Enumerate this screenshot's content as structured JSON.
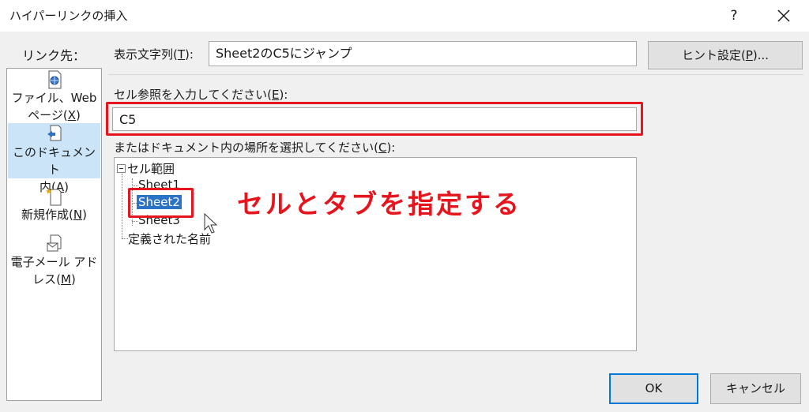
{
  "window": {
    "title": "ハイパーリンクの挿入",
    "help": "?"
  },
  "link_to": {
    "label": "リンク先：",
    "items": [
      {
        "label_line1": "ファイル、Web",
        "label_line2_pre": "ページ(",
        "mnemonic": "X",
        "label_line2_post": ")",
        "icon": "web-file-icon",
        "active": false
      },
      {
        "label_line1": "このドキュメント",
        "label_line2_pre": "内(",
        "mnemonic": "A",
        "label_line2_post": ")",
        "icon": "document-place-icon",
        "active": true
      },
      {
        "label_line1": "",
        "label_line2_pre": "新規作成(",
        "mnemonic": "N",
        "label_line2_post": ")",
        "icon": "new-document-icon",
        "active": false
      },
      {
        "label_line1": "電子メール アド",
        "label_line2_pre": "レス(",
        "mnemonic": "M",
        "label_line2_post": ")",
        "icon": "email-icon",
        "active": false
      }
    ]
  },
  "display_text": {
    "label_pre": "表示文字列(",
    "mnemonic": "T",
    "label_post": "):",
    "value": "Sheet2のC5にジャンプ"
  },
  "screentip_button": {
    "label_pre": "ヒント設定(",
    "mnemonic": "P",
    "label_post": ")..."
  },
  "cell_reference": {
    "label_pre": "セル参照を入力してください(",
    "mnemonic": "E",
    "label_post": "):",
    "value": "C5"
  },
  "place_in_doc": {
    "label_pre": "またはドキュメント内の場所を選択してください(",
    "mnemonic": "C",
    "label_post": "):"
  },
  "tree": {
    "root": "セル範囲",
    "sheets": [
      "Sheet1",
      "Sheet2",
      "Sheet3"
    ],
    "selected": "Sheet2",
    "defined_names": "定義された名前"
  },
  "annotation": "セルとタブを指定する",
  "buttons": {
    "ok": "OK",
    "cancel": "キャンセル"
  },
  "colors": {
    "highlight_red": "#e5141d",
    "selection_blue": "#2b73c6",
    "active_nav": "#cce4f7"
  }
}
